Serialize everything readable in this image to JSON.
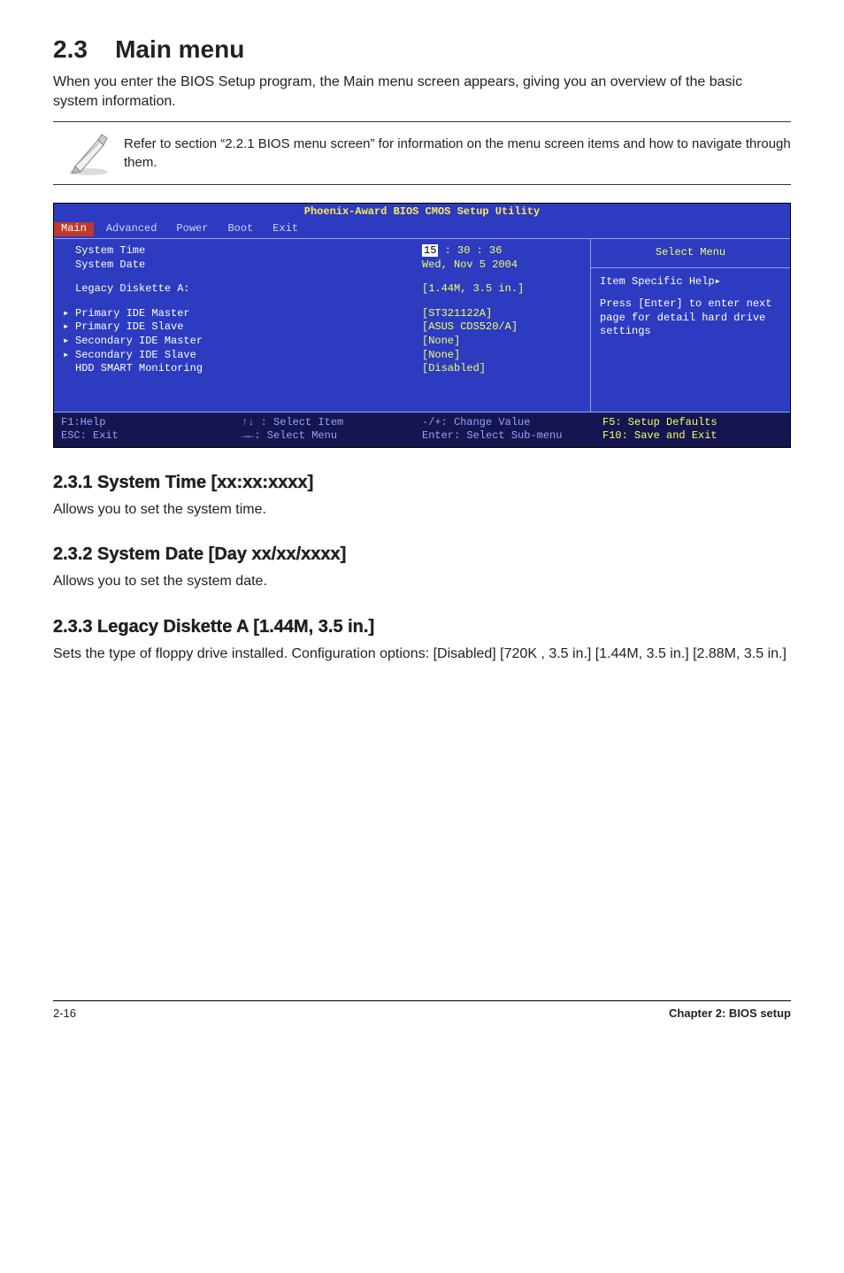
{
  "section": {
    "number": "2.3",
    "title": "Main menu",
    "intro": "When you enter the BIOS Setup program, the Main menu screen appears, giving you an overview of the basic system information.",
    "note": "Refer to section “2.2.1  BIOS menu screen” for information on the menu screen items and how to navigate through them."
  },
  "bios": {
    "title": "Phoenix-Award BIOS CMOS Setup Utility",
    "menu": [
      "Main",
      "Advanced",
      "Power",
      "Boot",
      "Exit"
    ],
    "selected_menu": "Main",
    "time_label": "System Time",
    "time_value_hour": "15",
    "time_value_rest": " : 30 : 36",
    "date_label": "System Date",
    "date_value": "Wed, Nov 5 2004",
    "rows": [
      {
        "k": "Legacy Diskette A:",
        "v": "[1.44M, 3.5 in.]",
        "tri": false,
        "gap_before": true
      },
      {
        "k": "Primary IDE Master",
        "v": "[ST321122A]",
        "tri": true,
        "gap_before": true
      },
      {
        "k": "Primary IDE Slave",
        "v": "[ASUS CDS520/A]",
        "tri": true
      },
      {
        "k": "Secondary IDE Master",
        "v": "[None]",
        "tri": true
      },
      {
        "k": "Secondary IDE Slave",
        "v": "[None]",
        "tri": true
      },
      {
        "k": "HDD SMART Monitoring",
        "v": "[Disabled]",
        "tri": false
      }
    ],
    "help_title": "Select Menu",
    "help_head2": "Item Specific Help",
    "help_body": "Press [Enter] to enter next page for detail hard drive settings",
    "foot": {
      "c1a": "F1:Help",
      "c1b": "ESC: Exit",
      "c2a": "↑↓ : Select Item",
      "c2b": "→←: Select Menu",
      "c3a": "-/+: Change Value",
      "c3b": "Enter: Select Sub-menu",
      "c4a": "F5: Setup Defaults",
      "c4b": "F10: Save and Exit"
    }
  },
  "subs": [
    {
      "num": "2.3.1",
      "title": "System Time [xx:xx:xxxx]",
      "body": "Allows you to set the system time."
    },
    {
      "num": "2.3.2",
      "title": "System Date [Day xx/xx/xxxx]",
      "body": "Allows you to set the system date."
    },
    {
      "num": "2.3.3",
      "title": "Legacy Diskette A [1.44M, 3.5 in.]",
      "body": "Sets the type of floppy drive installed. Configuration options: [Disabled] [720K , 3.5 in.] [1.44M, 3.5 in.] [2.88M, 3.5 in.]"
    }
  ],
  "footer": {
    "left": "2-16",
    "right": "Chapter 2: BIOS setup"
  }
}
